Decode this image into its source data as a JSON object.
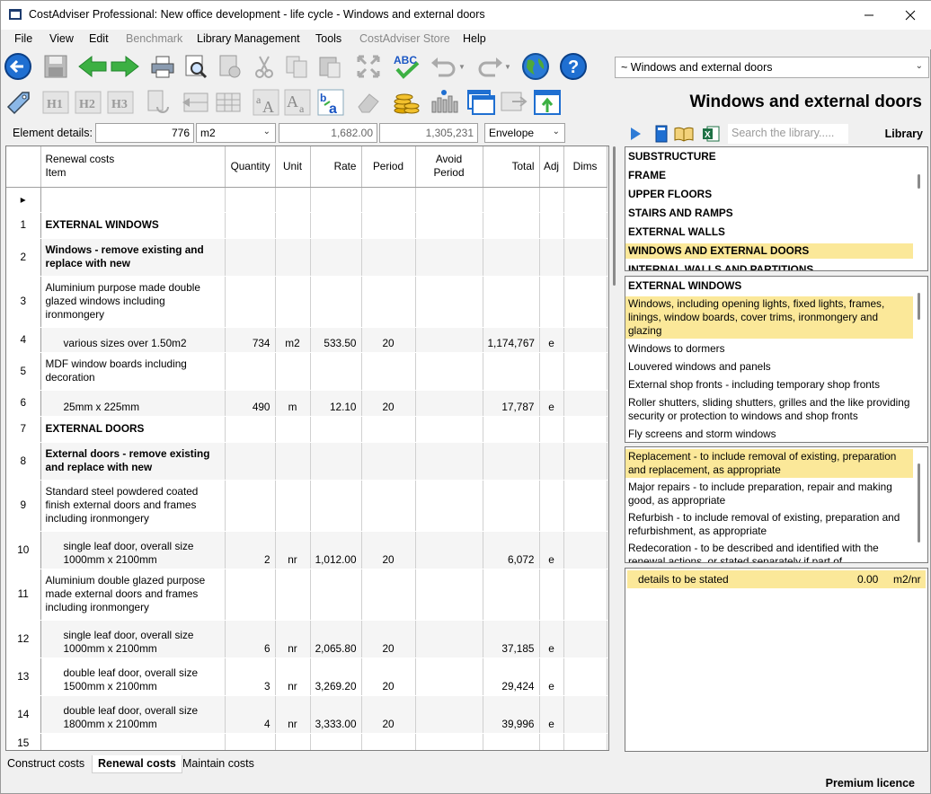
{
  "window": {
    "title": "CostAdviser Professional:  New office development - life cycle   -   Windows and external doors"
  },
  "menu": [
    "File",
    "View",
    "Edit",
    "Benchmark",
    "Library Management",
    "Tools",
    "CostAdviser Store",
    "Help"
  ],
  "menu_disabled": [
    "Benchmark",
    "CostAdviser Store"
  ],
  "toolbar": {
    "row1_icons": [
      "back-icon",
      "save-icon",
      "arrow-left-icon",
      "arrow-right-icon",
      "print-icon",
      "print-preview-icon",
      "new-page-icon",
      "cut-icon",
      "copy-icon",
      "paste-icon",
      "expand-icon",
      "spellcheck-icon",
      "undo-icon",
      "redo-icon",
      "globe-icon",
      "help-icon"
    ],
    "row2_icons": [
      "tag-icon",
      "h1-icon",
      "h2-icon",
      "h3-icon",
      "refresh-page-icon",
      "insert-row-icon",
      "table-icon",
      "font-size-up-icon",
      "font-size-down-icon",
      "font-color-icon",
      "eraser-icon",
      "coins-icon",
      "chart-icon",
      "windows-icon",
      "export-icon",
      "upload-icon"
    ],
    "spellcheck_label": "ABC",
    "h_labels": [
      "H1",
      "H2",
      "H3"
    ]
  },
  "library_selector": "~ Windows and external doors",
  "section_title": "Windows and external doors",
  "element_details": {
    "label": "Element details:",
    "quantity": "776",
    "unit": "m2",
    "value1": "1,682.00",
    "value2": "1,305,231",
    "category": "Envelope"
  },
  "grid": {
    "headers": {
      "item_top": "Renewal costs",
      "item": "Item",
      "quantity": "Quantity",
      "unit": "Unit",
      "rate": "Rate",
      "period": "Period",
      "avoid_period": "Avoid Period",
      "total": "Total",
      "adj": "Adj",
      "dims": "Dims"
    },
    "rows": [
      {
        "n": "1",
        "item": "EXTERNAL WINDOWS",
        "style": "bold",
        "qty": "",
        "unit": "",
        "rate": "",
        "period": "",
        "total": "",
        "adj": ""
      },
      {
        "n": "2",
        "item": "Windows - remove existing and replace with new",
        "style": "bold",
        "qty": "",
        "unit": "",
        "rate": "",
        "period": "",
        "total": "",
        "adj": ""
      },
      {
        "n": "3",
        "item": "Aluminium purpose made double glazed windows including ironmongery",
        "style": "",
        "qty": "",
        "unit": "",
        "rate": "",
        "period": "",
        "total": "",
        "adj": ""
      },
      {
        "n": "4",
        "item": "various sizes over 1.50m2",
        "style": "indent",
        "qty": "734",
        "unit": "m2",
        "rate": "533.50",
        "period": "20",
        "total": "1,174,767",
        "adj": "e"
      },
      {
        "n": "5",
        "item": "MDF window boards including decoration",
        "style": "",
        "qty": "",
        "unit": "",
        "rate": "",
        "period": "",
        "total": "",
        "adj": ""
      },
      {
        "n": "6",
        "item": "25mm x 225mm",
        "style": "indent",
        "qty": "490",
        "unit": "m",
        "rate": "12.10",
        "period": "20",
        "total": "17,787",
        "adj": "e"
      },
      {
        "n": "7",
        "item": "EXTERNAL DOORS",
        "style": "bold",
        "qty": "",
        "unit": "",
        "rate": "",
        "period": "",
        "total": "",
        "adj": ""
      },
      {
        "n": "8",
        "item": "External doors - remove existing and replace with new",
        "style": "bold",
        "qty": "",
        "unit": "",
        "rate": "",
        "period": "",
        "total": "",
        "adj": ""
      },
      {
        "n": "9",
        "item": "Standard steel powdered coated finish external doors and frames including ironmongery",
        "style": "",
        "qty": "",
        "unit": "",
        "rate": "",
        "period": "",
        "total": "",
        "adj": ""
      },
      {
        "n": "10",
        "item": "single leaf door, overall size 1000mm x 2100mm",
        "style": "indent",
        "qty": "2",
        "unit": "nr",
        "rate": "1,012.00",
        "period": "20",
        "total": "6,072",
        "adj": "e"
      },
      {
        "n": "11",
        "item": "Aluminium double glazed purpose made external doors and frames including ironmongery",
        "style": "",
        "qty": "",
        "unit": "",
        "rate": "",
        "period": "",
        "total": "",
        "adj": ""
      },
      {
        "n": "12",
        "item": "single leaf door, overall size 1000mm x 2100mm",
        "style": "indent",
        "qty": "6",
        "unit": "nr",
        "rate": "2,065.80",
        "period": "20",
        "total": "37,185",
        "adj": "e"
      },
      {
        "n": "13",
        "item": "double leaf door, overall size 1500mm x 2100mm",
        "style": "indent",
        "qty": "3",
        "unit": "nr",
        "rate": "3,269.20",
        "period": "20",
        "total": "29,424",
        "adj": "e"
      },
      {
        "n": "14",
        "item": "double leaf door, overall size 1800mm x 2100mm",
        "style": "indent",
        "qty": "4",
        "unit": "nr",
        "rate": "3,333.00",
        "period": "20",
        "total": "39,996",
        "adj": "e"
      },
      {
        "n": "15",
        "item": "",
        "style": "",
        "qty": "",
        "unit": "",
        "rate": "",
        "period": "",
        "total": "",
        "adj": ""
      }
    ]
  },
  "tabs": [
    "Construct costs",
    "Renewal costs",
    "Maintain costs"
  ],
  "active_tab": "Renewal costs",
  "status": "Premium licence",
  "library": {
    "search_placeholder": "Search the library.....",
    "label": "Library",
    "tool_icons": [
      "play-icon",
      "book-blue-icon",
      "book-open-icon",
      "excel-icon"
    ],
    "elements": [
      "SUBSTRUCTURE",
      "FRAME",
      "UPPER FLOORS",
      "STAIRS AND RAMPS",
      "EXTERNAL WALLS",
      "WINDOWS AND EXTERNAL DOORS",
      "INTERNAL WALLS AND PARTITIONS"
    ],
    "elements_selected": "WINDOWS AND EXTERNAL DOORS",
    "subheading": "EXTERNAL WINDOWS",
    "components": [
      "Windows, including opening lights, fixed lights, frames, linings, window boards, cover trims, ironmongery and glazing",
      "Windows to dormers",
      "Louvered windows and panels",
      "External shop fronts - including temporary shop fronts",
      "Roller shutters, sliding shutters, grilles and the like providing security or protection to windows and shop fronts",
      "Fly screens and storm windows"
    ],
    "components_selected": 0,
    "actions": [
      "Replacement - to include removal of existing, preparation and replacement, as appropriate",
      "Major repairs - to include preparation, repair and making good, as appropriate",
      "Refurbish - to include removal of existing, preparation and refurbishment, as appropriate",
      "Redecoration - to be described and identified with the renewal actions, or stated separately if part of"
    ],
    "actions_selected": 0,
    "detail": {
      "text": "details to be stated",
      "value": "0.00",
      "unit": "m2/nr"
    }
  },
  "colors": {
    "highlight": "#fbe899",
    "accent_blue": "#1f6fd1",
    "green": "#3cb043"
  }
}
